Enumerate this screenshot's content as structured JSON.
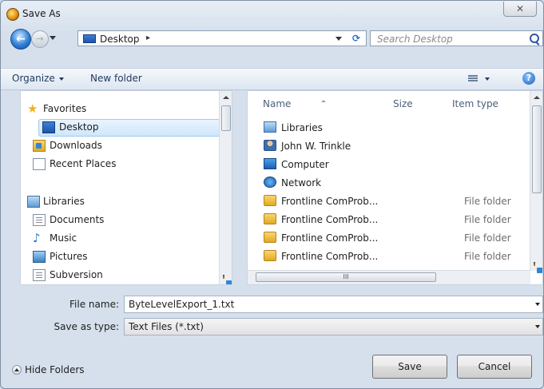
{
  "window": {
    "title": "Save As",
    "close_glyph": "✕"
  },
  "nav": {
    "back_icon": "←",
    "forward_icon": "→",
    "address": {
      "location": "Desktop",
      "separator_glyph": "▸",
      "refresh_icon": "⟳"
    },
    "search": {
      "placeholder": "Search Desktop"
    }
  },
  "toolbar": {
    "organize_label": "Organize",
    "new_folder_label": "New folder",
    "help_glyph": "?"
  },
  "sidebar": {
    "favorites": {
      "label": "Favorites",
      "items": [
        {
          "label": "Desktop",
          "selected": true
        },
        {
          "label": "Downloads"
        },
        {
          "label": "Recent Places"
        }
      ]
    },
    "libraries": {
      "label": "Libraries",
      "items": [
        {
          "label": "Documents"
        },
        {
          "label": "Music"
        },
        {
          "label": "Pictures"
        },
        {
          "label": "Subversion"
        }
      ]
    }
  },
  "file_list": {
    "columns": [
      "Name",
      "Size",
      "Item type"
    ],
    "rows": [
      {
        "name": "Libraries",
        "type": "",
        "icon": "library-icon"
      },
      {
        "name": "John W. Trinkle",
        "type": "",
        "icon": "user-folder-icon"
      },
      {
        "name": "Computer",
        "type": "",
        "icon": "computer-icon"
      },
      {
        "name": "Network",
        "type": "",
        "icon": "network-icon"
      },
      {
        "name": "Frontline ComProb...",
        "type": "File folder",
        "icon": "folder-icon"
      },
      {
        "name": "Frontline ComProb...",
        "type": "File folder",
        "icon": "folder-icon"
      },
      {
        "name": "Frontline ComProb...",
        "type": "File folder",
        "icon": "folder-icon"
      },
      {
        "name": "Frontline ComProb...",
        "type": "File folder",
        "icon": "folder-icon"
      }
    ],
    "scroll_grip": "III"
  },
  "form": {
    "file_name_label": "File name:",
    "file_name_value": "ByteLevelExport_1.txt",
    "save_type_label": "Save as type:",
    "save_type_value": "Text Files (*.txt)"
  },
  "footer": {
    "hide_folders_label": "Hide Folders",
    "save_label": "Save",
    "cancel_label": "Cancel"
  }
}
